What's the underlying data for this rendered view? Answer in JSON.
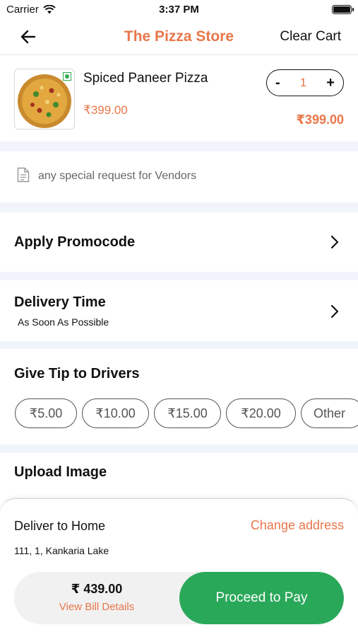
{
  "status_bar": {
    "carrier": "Carrier",
    "time": "3:37 PM"
  },
  "header": {
    "title": "The Pizza Store",
    "clear_cart": "Clear Cart"
  },
  "cart_item": {
    "name": "Spiced Paneer Pizza",
    "unit_price": "₹399.00",
    "quantity": "1",
    "minus": "-",
    "plus": "+",
    "line_total": "₹399.00"
  },
  "special_request": {
    "placeholder": "any special request for Vendors"
  },
  "promocode": {
    "label": "Apply Promocode"
  },
  "delivery_time": {
    "label": "Delivery Time",
    "value": "As Soon As Possible"
  },
  "tips": {
    "label": "Give Tip to Drivers",
    "options": [
      "₹5.00",
      "₹10.00",
      "₹15.00",
      "₹20.00",
      "Other"
    ]
  },
  "upload_image": {
    "label": "Upload Image"
  },
  "checkout": {
    "deliver_to": "Deliver to Home",
    "change_address": "Change address",
    "address": "111, 1, Kankaria Lake",
    "total": "₹ 439.00",
    "view_bill": "View Bill Details",
    "proceed": "Proceed to Pay"
  },
  "colors": {
    "accent": "#e8774a",
    "pay_button": "#2aa85a",
    "band": "#f1f4fa"
  }
}
